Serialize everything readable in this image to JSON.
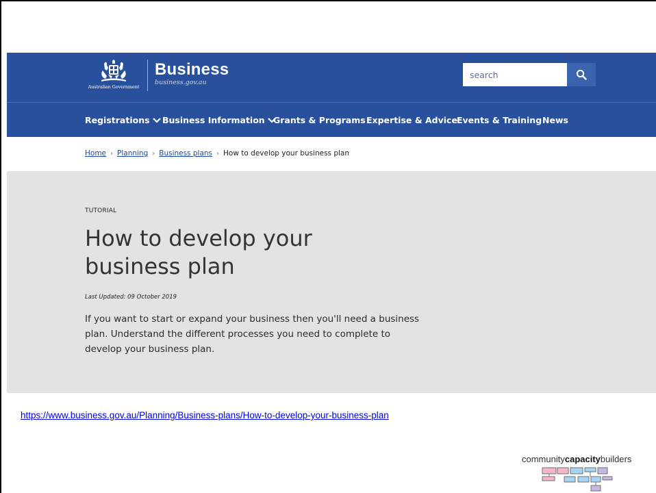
{
  "header": {
    "crest_caption": "Australian Government",
    "brand_title": "Business",
    "brand_url": "business.gov.au",
    "search_placeholder": "search",
    "search_icon": "search-icon"
  },
  "nav": {
    "items": [
      {
        "label": "Registrations",
        "has_dropdown": true
      },
      {
        "label": "Business Information",
        "has_dropdown": true
      },
      {
        "label": "Grants & Programs",
        "has_dropdown": false
      },
      {
        "label": "Expertise & Advice",
        "has_dropdown": false
      },
      {
        "label": "Events & Training",
        "has_dropdown": false
      },
      {
        "label": "News",
        "has_dropdown": false
      }
    ]
  },
  "breadcrumb": {
    "items": [
      "Home",
      "Planning",
      "Business plans"
    ],
    "current": "How to develop your business plan",
    "separator": "›"
  },
  "hero": {
    "eyebrow": "TUTORIAL",
    "title": "How to develop your business plan",
    "updated": "Last Updated: 09 October 2019",
    "intro": "If you want to start or expand your business then you'll need a business plan. Understand the different processes you need to complete to develop your business plan."
  },
  "source_url": "https://www.business.gov.au/Planning/Business-plans/How-to-develop-your-business-plan",
  "footer_logo": {
    "text_prefix": "community",
    "text_bold": "capacity",
    "text_suffix": "builders"
  },
  "colors": {
    "header_blue": "#28509c",
    "search_button": "#3b63ae",
    "hero_grey": "#e3e3e3",
    "link_blue": "#1a4aa0",
    "logo_pink": "#f2b8c8",
    "logo_blue": "#a9d3f2",
    "logo_purple": "#c7b8e0"
  }
}
